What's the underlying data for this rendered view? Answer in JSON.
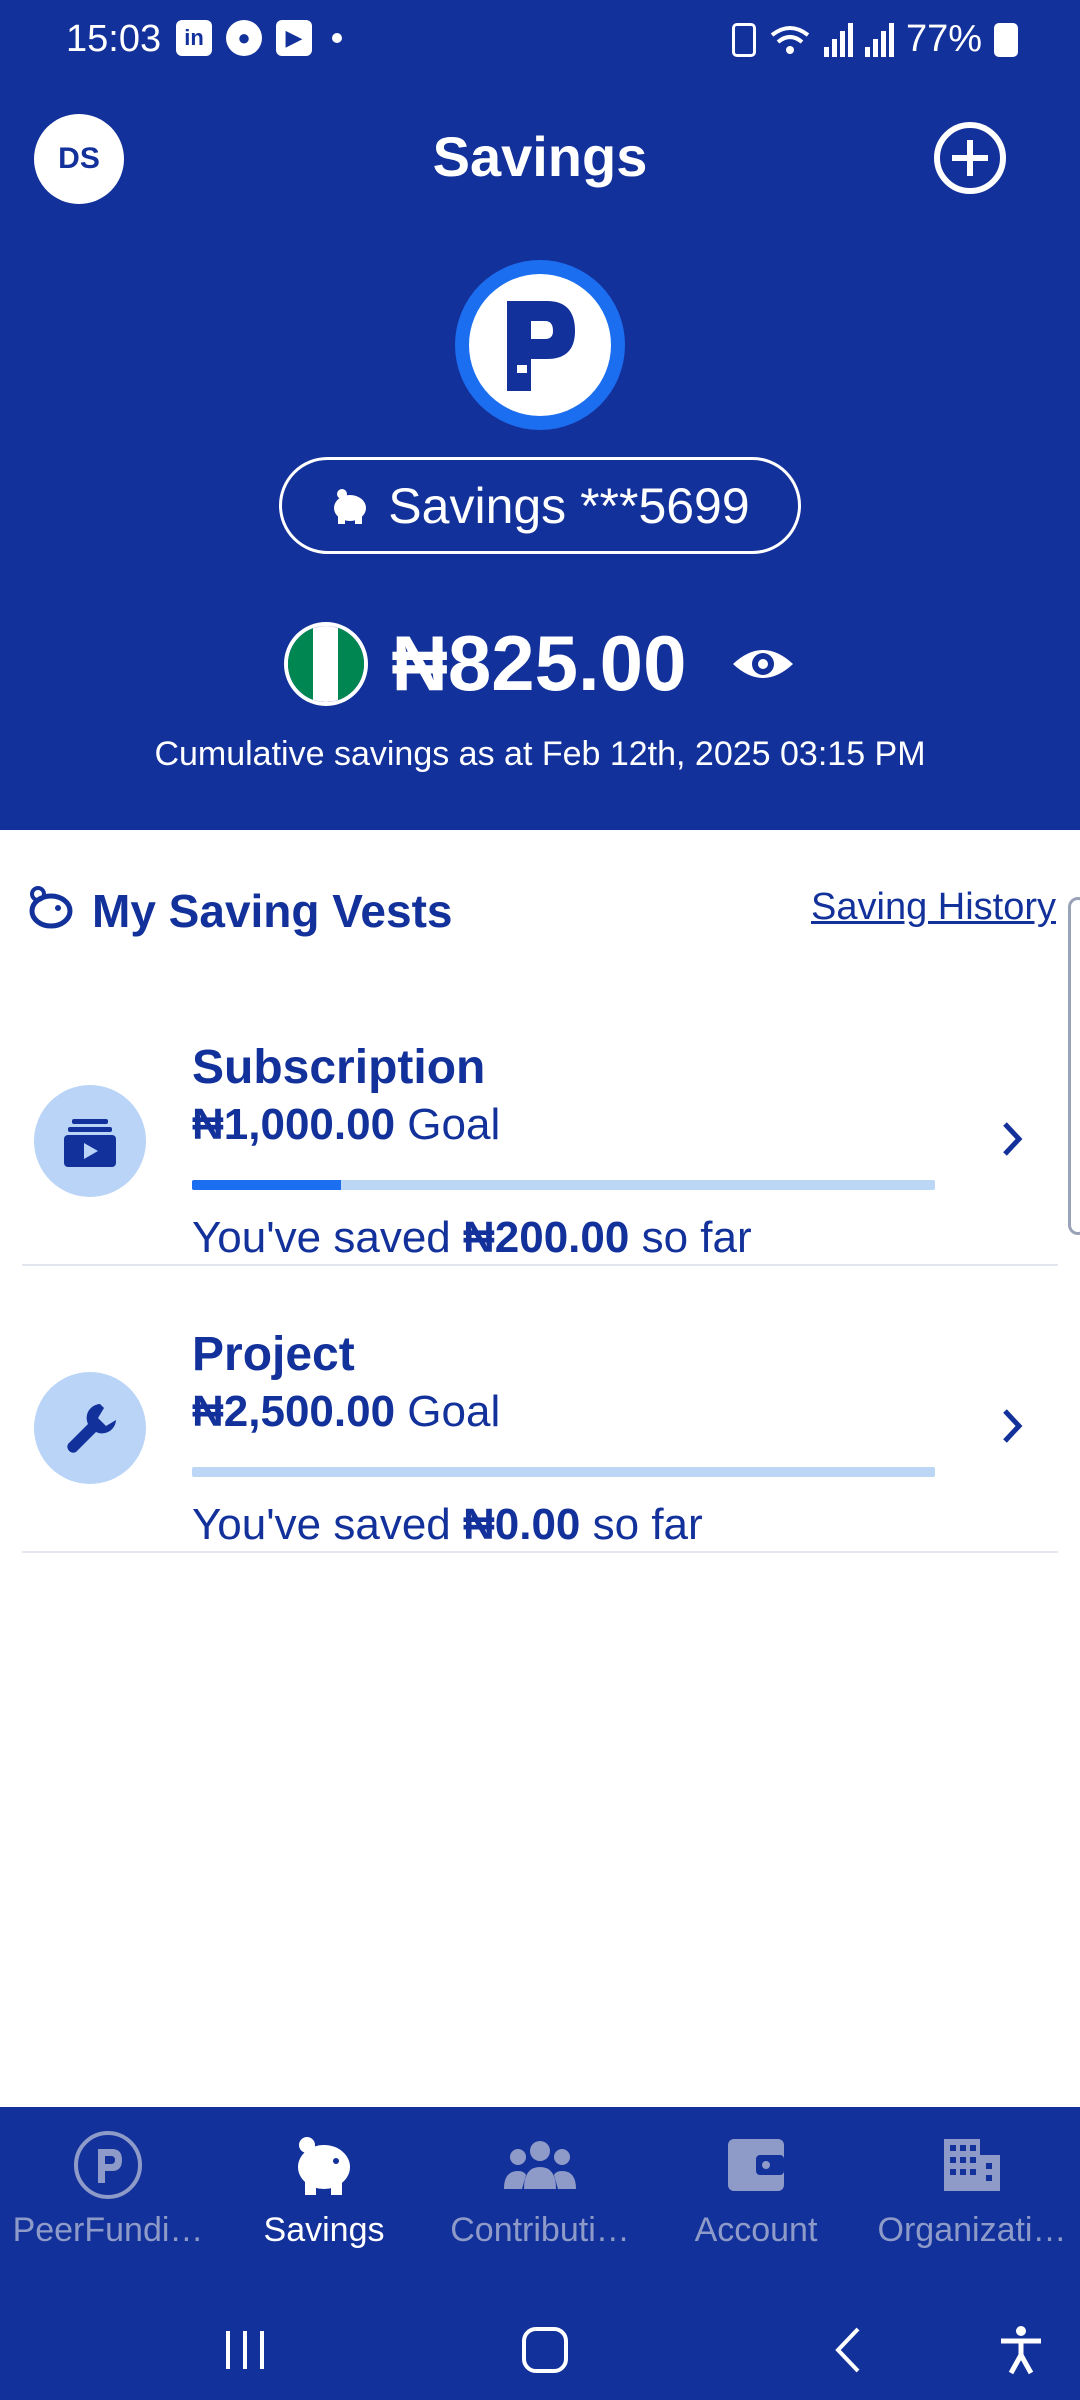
{
  "status_bar": {
    "time": "15:03",
    "battery": "77%"
  },
  "header": {
    "avatar_initials": "DS",
    "title": "Savings",
    "account_label": "Savings ***5699",
    "balance": "₦825.00",
    "cumulative_text": "Cumulative savings as at Feb 12th, 2025 03:15 PM"
  },
  "section": {
    "title": "My Saving Vests",
    "history_link": "Saving History"
  },
  "vests": [
    {
      "name": "Subscription",
      "goal_amount": "₦1,000.00",
      "goal_suffix": " Goal",
      "saved_prefix": "You've saved ",
      "saved_amount": "₦200.00",
      "saved_suffix": " so far",
      "progress": 0.2,
      "icon": "subscription-icon"
    },
    {
      "name": "Project",
      "goal_amount": "₦2,500.00",
      "goal_suffix": " Goal",
      "saved_prefix": "You've saved ",
      "saved_amount": "₦0.00",
      "saved_suffix": " so far",
      "progress": 0,
      "icon": "wrench-icon"
    }
  ],
  "bottom_nav": {
    "items": [
      {
        "label": "PeerFundi…",
        "icon": "peerfunding-icon",
        "active": false
      },
      {
        "label": "Savings",
        "icon": "piggy-bank-icon",
        "active": true
      },
      {
        "label": "Contributi…",
        "icon": "people-icon",
        "active": false
      },
      {
        "label": "Account",
        "icon": "wallet-icon",
        "active": false
      },
      {
        "label": "Organizati…",
        "icon": "building-icon",
        "active": false
      }
    ]
  },
  "colors": {
    "primary": "#13319a",
    "accent": "#1c6ef0",
    "light_accent": "#b9d4f7",
    "inactive_nav": "#8e9bc8"
  }
}
